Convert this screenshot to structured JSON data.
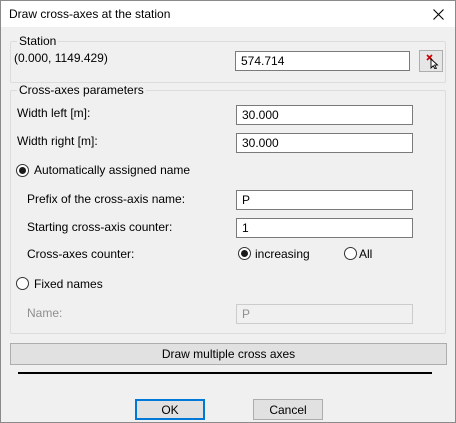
{
  "window": {
    "title": "Draw cross-axes at the station"
  },
  "station": {
    "group_title": "Station",
    "coordinates": "(0.000, 1149.429)",
    "value": "574.714",
    "pick_icon": "pick-station-cursor-icon"
  },
  "params": {
    "group_title": "Cross-axes parameters",
    "width_left_label": "Width left [m]:",
    "width_left_value": "30.000",
    "width_right_label": "Width right [m]:",
    "width_right_value": "30.000",
    "auto_name_label": "Automatically assigned name",
    "auto_name_selected": true,
    "prefix_label": "Prefix of the cross-axis name:",
    "prefix_value": "P",
    "start_counter_label": "Starting cross-axis counter:",
    "start_counter_value": "1",
    "counter_label": "Cross-axes counter:",
    "counter_increasing_label": "increasing",
    "counter_all_label": "All",
    "counter_selected": "increasing",
    "fixed_names_label": "Fixed names",
    "fixed_names_selected": false,
    "name_label": "Name:",
    "name_value": "P"
  },
  "buttons": {
    "draw_multiple": "Draw multiple cross axes",
    "ok": "OK",
    "cancel": "Cancel"
  },
  "colors": {
    "accent": "#0078d7",
    "pick_icon_red": "#cc0000"
  }
}
